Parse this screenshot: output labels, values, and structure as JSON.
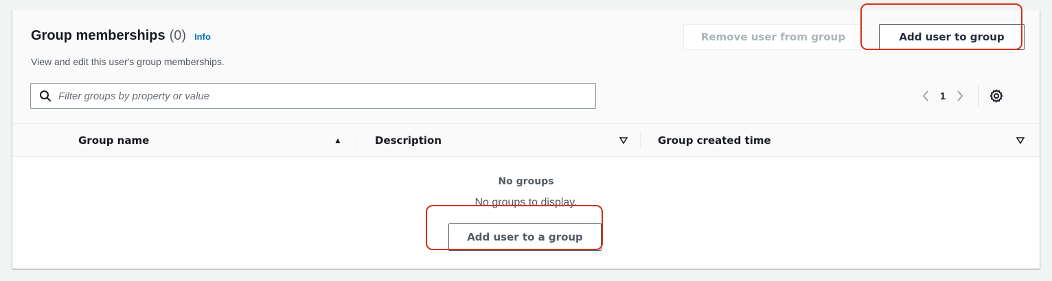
{
  "header": {
    "title": "Group memberships",
    "count": "(0)",
    "info_label": "Info",
    "description": "View and edit this user's group memberships."
  },
  "actions": {
    "remove_label": "Remove user from group",
    "add_label": "Add user to group"
  },
  "filter": {
    "placeholder": "Filter groups by property or value",
    "value": ""
  },
  "pagination": {
    "current_page": "1",
    "prev_icon": "chevron-left-icon",
    "next_icon": "chevron-right-icon",
    "settings_icon": "gear-icon"
  },
  "table": {
    "columns": [
      {
        "label": "Group name",
        "sort": "ascending"
      },
      {
        "label": "Description",
        "sort": "none"
      },
      {
        "label": "Group created time",
        "sort": "none"
      }
    ],
    "rows": []
  },
  "empty_state": {
    "title": "No groups",
    "message": "No groups to display.",
    "action_label": "Add user to a group"
  },
  "colors": {
    "highlight": "#d13212",
    "link": "#0073bb",
    "background": "#f2f3f3"
  }
}
